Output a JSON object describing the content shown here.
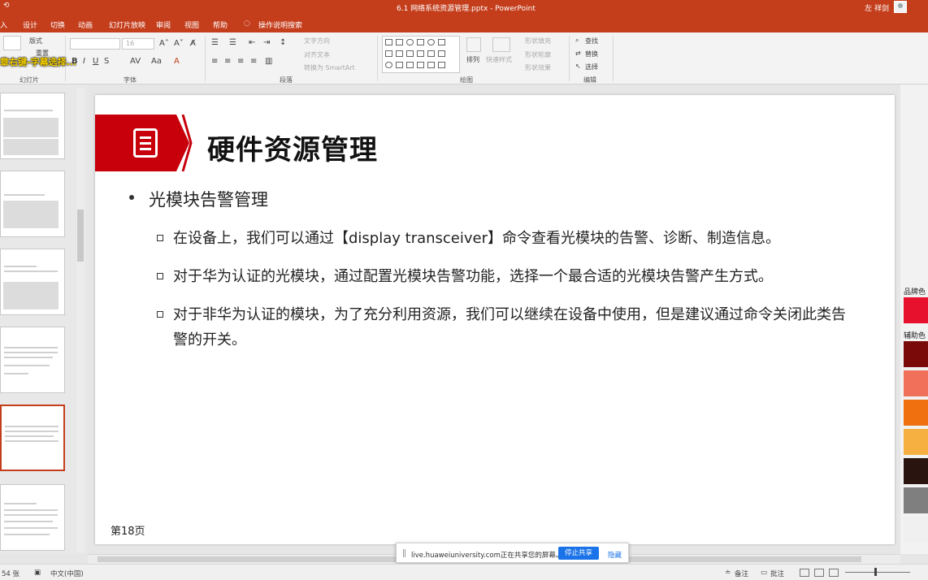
{
  "window": {
    "title": "6.1 网络系统资源管理.pptx - PowerPoint",
    "user": "左 祥剑"
  },
  "tabs": [
    "入",
    "设计",
    "切换",
    "动画",
    "幻灯片放映",
    "审阅",
    "视图",
    "帮助",
    "操作说明搜索"
  ],
  "ribbon": {
    "groups": [
      "幻灯片",
      "字体",
      "段落",
      "绘图",
      "编辑"
    ],
    "slides_group": {
      "layout": "版式",
      "reset": "重置"
    },
    "font_size": "16",
    "paragraph": {
      "text_direction": "文字方向",
      "align_text": "对齐文本",
      "smartart": "转换为 SmartArt"
    },
    "drawing": {
      "arrange": "排列",
      "quick_styles": "快速样式",
      "fill": "形状填充",
      "outline": "形状轮廓",
      "effects": "形状效果"
    },
    "editing": {
      "find": "查找",
      "replace": "替换",
      "select": "选择"
    }
  },
  "overlay_subtitle": "章右键-字幕选择...",
  "slide": {
    "title": "硬件资源管理",
    "bullet": "光模块告警管理",
    "sub_bullets": [
      "在设备上，我们可以通过【display transceiver】命令查看光模块的告警、诊断、制造信息。",
      "对于华为认证的光模块，通过配置光模块告警功能，选择一个最合适的光模块告警产生方式。",
      "对于非华为认证的模块，为了充分利用资源，我们可以继续在设备中使用，但是建议通过命令关闭此类告警的开关。"
    ],
    "page_number": "第18页"
  },
  "right_panel": {
    "brand_label": "品牌色",
    "aux_label": "辅助色",
    "swatches": [
      "#e8112d",
      "#7a0a0a",
      "#f0705a",
      "#f07010",
      "#f5b041",
      "#2a1410",
      "#7f7f7f",
      "#f0f0f0"
    ]
  },
  "share_toast": {
    "message": "live.huaweiuniversity.com正在共享您的屏幕。",
    "stop": "停止共享",
    "hide": "隐藏"
  },
  "status": {
    "slide_count": "54 张",
    "language": "中文(中国)",
    "notes": "备注",
    "comments": "批注"
  },
  "colors": {
    "accent": "#c43e1c",
    "slide_red": "#c7000b"
  }
}
